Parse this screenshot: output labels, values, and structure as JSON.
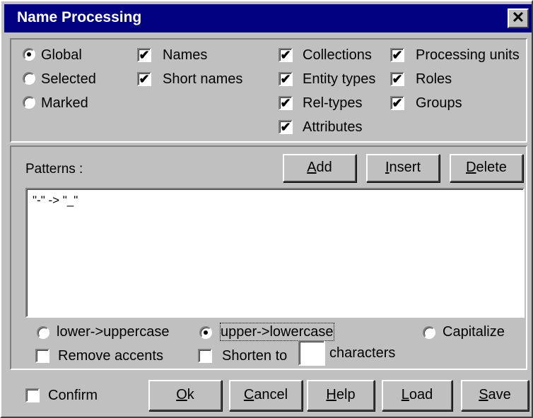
{
  "window": {
    "title": "Name Processing",
    "close_glyph": "✕"
  },
  "scope": {
    "options": [
      {
        "label": "Global",
        "selected": true
      },
      {
        "label": "Selected",
        "selected": false
      },
      {
        "label": "Marked",
        "selected": false
      }
    ]
  },
  "objects": {
    "items": [
      {
        "label": "Names",
        "checked": true
      },
      {
        "label": "Short names",
        "checked": true
      },
      {
        "label": "Collections",
        "checked": true
      },
      {
        "label": "Entity types",
        "checked": true
      },
      {
        "label": "Rel-types",
        "checked": true
      },
      {
        "label": "Attributes",
        "checked": true
      },
      {
        "label": "Processing units",
        "checked": true
      },
      {
        "label": "Roles",
        "checked": true
      },
      {
        "label": "Groups",
        "checked": true
      }
    ]
  },
  "patterns": {
    "label": "Patterns :",
    "add_label": "Add",
    "add_key": "A",
    "add_rest": "dd",
    "insert_label": "Insert",
    "insert_key": "I",
    "insert_rest": "nsert",
    "delete_label": "Delete",
    "delete_key": "D",
    "delete_rest": "elete",
    "entries": [
      "\"-\" -> \"_\""
    ]
  },
  "case": {
    "options": [
      {
        "label": "lower->uppercase",
        "selected": false
      },
      {
        "label": "upper->lowercase",
        "selected": true
      },
      {
        "label": "Capitalize",
        "selected": false
      }
    ]
  },
  "transform": {
    "remove_accents": {
      "label": "Remove accents",
      "checked": false
    },
    "shorten": {
      "label": "Shorten to",
      "checked": false,
      "value": "",
      "suffix": "characters"
    }
  },
  "footer": {
    "confirm": {
      "label": "Confirm",
      "checked": false
    },
    "ok": {
      "key": "O",
      "rest": "k"
    },
    "cancel": {
      "key": "C",
      "rest": "ancel"
    },
    "help": {
      "key": "H",
      "rest": "elp"
    },
    "load": {
      "key": "L",
      "rest": "oad"
    },
    "save": {
      "key": "S",
      "rest": "ave"
    }
  },
  "colors": {
    "titlebar": "#000080",
    "face": "#c0c0c0"
  },
  "icons": {
    "check": "✔",
    "close": "close-icon"
  }
}
